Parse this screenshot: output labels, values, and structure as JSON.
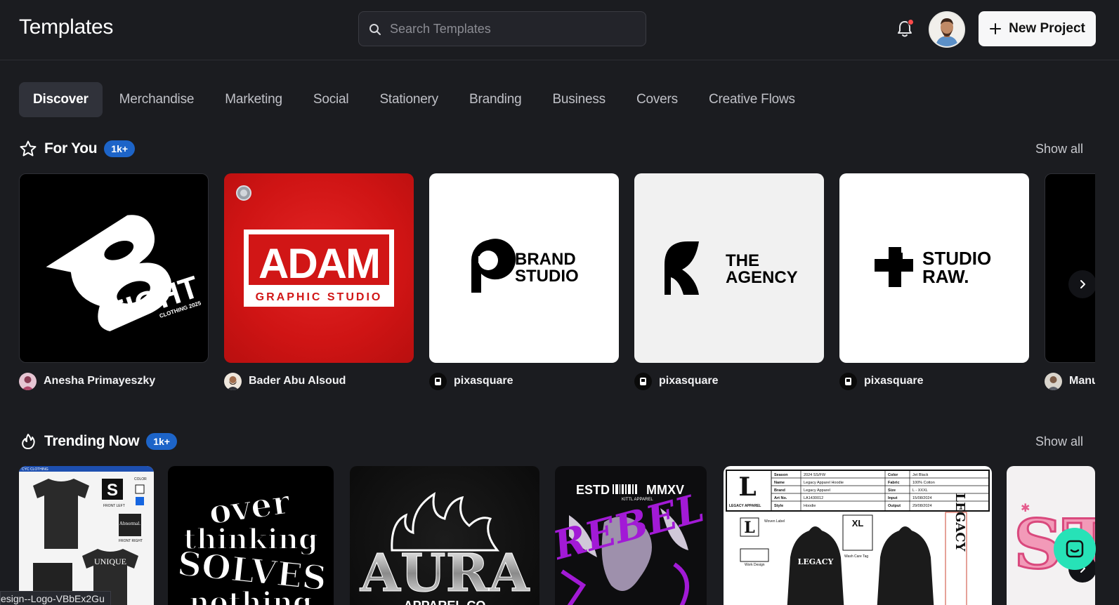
{
  "header": {
    "title": "Templates",
    "search_placeholder": "Search Templates",
    "new_project_label": "New Project"
  },
  "tabs": [
    {
      "label": "Discover",
      "active": true
    },
    {
      "label": "Merchandise"
    },
    {
      "label": "Marketing"
    },
    {
      "label": "Social"
    },
    {
      "label": "Stationery"
    },
    {
      "label": "Branding"
    },
    {
      "label": "Business"
    },
    {
      "label": "Covers"
    },
    {
      "label": "Creative Flows"
    }
  ],
  "for_you": {
    "title": "For You",
    "badge": "1k+",
    "show_all": "Show all",
    "cards": [
      {
        "author": "Anesha Primayeszky",
        "art": {
          "word": "EIGHT",
          "sub": "CLOTHING 2025",
          "mark": "8"
        }
      },
      {
        "author": "Bader Abu Alsoud",
        "art": {
          "word": "ADAM",
          "sub": "GRAPHIC STUDIO"
        }
      },
      {
        "author": "pixasquare",
        "art": {
          "line1": "BRAND",
          "line2": "STUDIO"
        }
      },
      {
        "author": "pixasquare",
        "art": {
          "line1": "THE",
          "line2": "AGENCY"
        }
      },
      {
        "author": "pixasquare",
        "art": {
          "line1": "STUDIO",
          "line2": "RAW."
        }
      },
      {
        "author": "Manu"
      }
    ]
  },
  "trending": {
    "title": "Trending Now",
    "badge": "1k+",
    "show_all": "Show all",
    "cards": [
      {
        "art": {
          "brand": "CYC CLOTHING",
          "label1": "COLOR",
          "label2": "FRONT LEFT",
          "label3": "Abnormal.",
          "label4": "FRONT RIGHT",
          "label5": "UNIQUE"
        }
      },
      {
        "art": {
          "line1": "over",
          "line2": "thinking",
          "line3": "SOLVES",
          "line4": "nothing"
        }
      },
      {
        "art": {
          "word": "AURA",
          "sub": "APPAREL.CO"
        }
      },
      {
        "art": {
          "top1": "ESTD",
          "top2": "MMXV",
          "word": "REBEL",
          "sub": "KITTL APPAREL"
        }
      },
      {
        "art": {
          "rows": [
            [
              "Season",
              "2024 SS/FW",
              "Color",
              "Jet Black"
            ],
            [
              "Name",
              "Legacy Apparel Hoodie",
              "Fabric",
              "100% Cotton"
            ],
            [
              "Brand",
              "Legacy Apparel",
              "Size",
              "L - XXXL"
            ],
            [
              "Art No.",
              "LA1430012",
              "Input",
              "15/08/2024"
            ],
            [
              "Style",
              "Hoodie",
              "Output",
              "29/08/2024"
            ]
          ],
          "brand": "LEGACY APPAREL",
          "size": "XL",
          "woven": "Woven Label",
          "wash": "Wash Care Tag",
          "work": "Work Design",
          "word": "LEGACY"
        }
      },
      {
        "art": {
          "word": "ST"
        }
      }
    ]
  },
  "status_url": "esign--Logo-VBbEx2Gu"
}
